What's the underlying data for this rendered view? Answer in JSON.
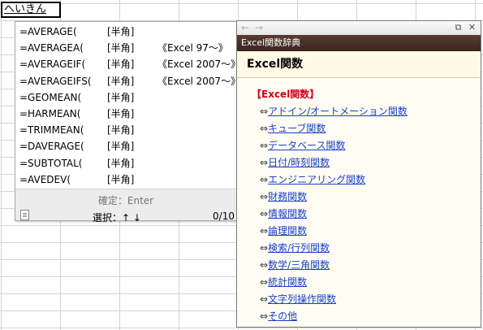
{
  "sheet": {
    "cell_input": "へいきん"
  },
  "candidates": {
    "items": [
      {
        "fn": "=AVERAGE(",
        "width": "[半角]",
        "note": ""
      },
      {
        "fn": "=AVERAGEA(",
        "width": "[半角]",
        "note": "《Excel 97～》"
      },
      {
        "fn": "=AVERAGEIF(",
        "width": "[半角]",
        "note": "《Excel 2007～》"
      },
      {
        "fn": "=AVERAGEIFS(",
        "width": "[半角]",
        "note": "《Excel 2007～》"
      },
      {
        "fn": "=GEOMEAN(",
        "width": "[半角]",
        "note": ""
      },
      {
        "fn": "=HARMEAN(",
        "width": "[半角]",
        "note": ""
      },
      {
        "fn": "=TRIMMEAN(",
        "width": "[半角]",
        "note": ""
      },
      {
        "fn": "=DAVERAGE(",
        "width": "[半角]",
        "note": ""
      },
      {
        "fn": "=SUBTOTAL(",
        "width": "[半角]",
        "note": ""
      },
      {
        "fn": "=AVEDEV(",
        "width": "[半角]",
        "note": ""
      }
    ],
    "confirm_hint": "確定：Enter",
    "select_hint": "選択：↑ ↓",
    "page_counter": "0/10",
    "icon": "document-icon"
  },
  "dictionary": {
    "nav_back": "←",
    "nav_forward": "→",
    "restore": "⧉",
    "close": "✕",
    "title": "Excel関数辞典",
    "heading": "Excel関数",
    "section": "【Excel関数】",
    "arrow": "⇔",
    "links": [
      "アドイン/オートメーション関数",
      "キューブ関数",
      "データベース関数",
      "日付/時刻関数",
      "エンジニアリング関数",
      "財務関数",
      "情報関数",
      "論理関数",
      "検索/行列関数",
      "数学/三角関数",
      "統計関数",
      "文字列操作関数",
      "その他"
    ]
  }
}
